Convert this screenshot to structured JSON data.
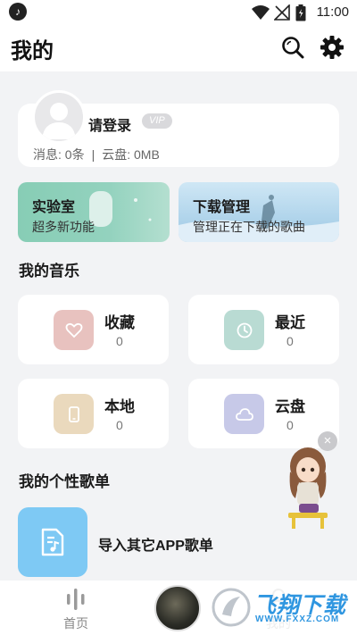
{
  "status_bar": {
    "time": "11:00",
    "note_glyph": "♪"
  },
  "header": {
    "title": "我的",
    "search_icon": "search-icon",
    "settings_icon": "gear-icon"
  },
  "profile": {
    "login_label": "请登录",
    "vip_badge": "VIP",
    "messages_label": "消息: 0条",
    "separator": "|",
    "cloud_label": "云盘: 0MB"
  },
  "banners": [
    {
      "title": "实验室",
      "subtitle": "超多新功能",
      "color": "#8fcfb9"
    },
    {
      "title": "下载管理",
      "subtitle": "管理正在下载的歌曲",
      "color": "#b9d9ee"
    }
  ],
  "my_music": {
    "title": "我的音乐",
    "tiles": [
      {
        "label": "收藏",
        "count": "0",
        "icon": "heart-icon",
        "color": "#e8c2bf"
      },
      {
        "label": "最近",
        "count": "0",
        "icon": "clock-icon",
        "color": "#b9dbd3"
      },
      {
        "label": "本地",
        "count": "0",
        "icon": "phone-icon",
        "color": "#ead9bd"
      },
      {
        "label": "云盘",
        "count": "0",
        "icon": "cloud-icon",
        "color": "#c7c9e8"
      }
    ]
  },
  "playlists": {
    "title": "我的个性歌单",
    "import_label": "导入其它APP歌单"
  },
  "close_glyph": "×",
  "tabbar": {
    "home_label": "首页",
    "mine_label": "我的"
  },
  "watermark": {
    "brand": "飞翔下载",
    "url": "WWW.FXXZ.COM"
  }
}
